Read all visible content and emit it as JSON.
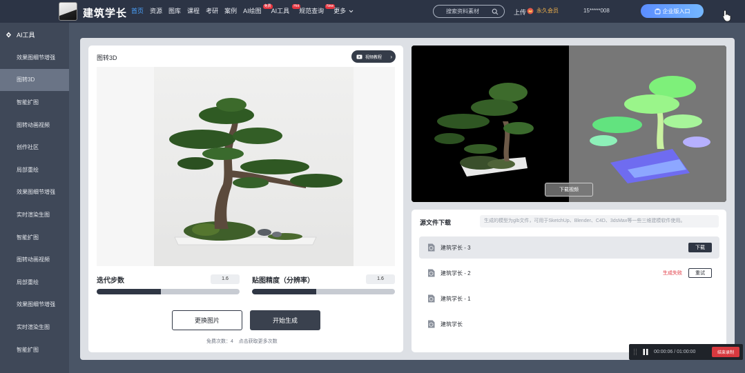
{
  "header": {
    "logo_text": "建筑学长",
    "nav": [
      {
        "label": "首页",
        "active": true,
        "badge": ""
      },
      {
        "label": "资源",
        "active": false,
        "badge": ""
      },
      {
        "label": "图库",
        "active": false,
        "badge": ""
      },
      {
        "label": "课程",
        "active": false,
        "badge": ""
      },
      {
        "label": "考研",
        "active": false,
        "badge": ""
      },
      {
        "label": "案例",
        "active": false,
        "badge": ""
      },
      {
        "label": "AI绘图",
        "active": false,
        "badge": "免费"
      },
      {
        "label": "AI工具",
        "active": false,
        "badge": "Hot"
      },
      {
        "label": "规范查询",
        "active": false,
        "badge": "New"
      },
      {
        "label": "更多",
        "active": false,
        "badge": ""
      }
    ],
    "search_placeholder": "搜索资料素材",
    "upload_label": "上传",
    "vip_label": "永久会员",
    "phone": "15*****008",
    "enterprise_label": "企业版入口"
  },
  "sidebar": {
    "title": "AI工具",
    "items": [
      {
        "label": "效果图细节增强",
        "active": false
      },
      {
        "label": "图转3D",
        "active": true
      },
      {
        "label": "智能扩图",
        "active": false
      },
      {
        "label": "图转动画视频",
        "active": false
      },
      {
        "label": "创作社区",
        "active": false
      },
      {
        "label": "局部重绘",
        "active": false
      },
      {
        "label": "效果图细节增强",
        "active": false
      },
      {
        "label": "实时渲染生图",
        "active": false
      },
      {
        "label": "智能扩图",
        "active": false
      },
      {
        "label": "图转动画视频",
        "active": false
      },
      {
        "label": "局部重绘",
        "active": false
      },
      {
        "label": "效果图细节增强",
        "active": false
      },
      {
        "label": "实时渲染生图",
        "active": false
      },
      {
        "label": "智能扩图",
        "active": false
      }
    ]
  },
  "tool": {
    "title": "图转3D",
    "tutorial_label": "视频教程",
    "steps_label": "迭代步数",
    "steps_value": "1.6",
    "steps_fraction": 0.45,
    "precision_label": "贴图精度（分辨率）",
    "precision_value": "1.6",
    "precision_fraction": 0.45,
    "change_image_label": "更换图片",
    "generate_label": "开始生成",
    "free_count_text": "免费次数：4    点击获取更多次数"
  },
  "preview": {
    "download_video_label": "下载视频"
  },
  "source_files": {
    "title": "源文件下载",
    "description": "生成的模型为glb文件，可用于SketchUp、Blender、C4D、3dsMax等一些三维建模软件使用。",
    "files": [
      {
        "name": "建筑学长 - 3",
        "status": "download",
        "action_label": "下载",
        "fail_label": ""
      },
      {
        "name": "建筑学长 - 2",
        "status": "failed",
        "action_label": "重试",
        "fail_label": "生成失败"
      },
      {
        "name": "建筑学长 - 1",
        "status": "none",
        "action_label": "",
        "fail_label": ""
      },
      {
        "name": "建筑学长",
        "status": "none",
        "action_label": "",
        "fail_label": ""
      }
    ]
  },
  "recorder": {
    "time": "00:00:06 / 01:00:00",
    "end_label": "结束录制"
  },
  "colors": {
    "accent_blue": "#4aa3ff",
    "dark": "#2f3644",
    "fail_red": "#e0353f",
    "vip_gold": "#f3b24a"
  }
}
